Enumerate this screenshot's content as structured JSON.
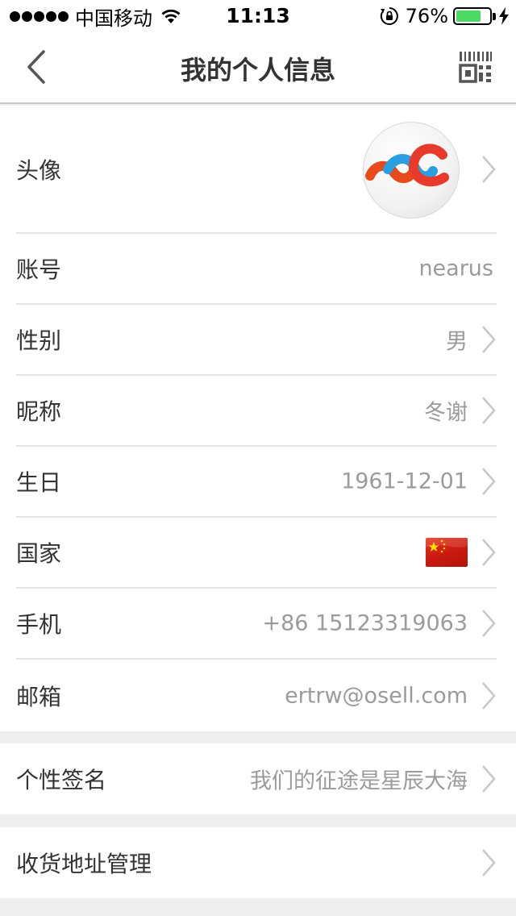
{
  "status_bar": {
    "carrier": "中国移动",
    "time": "11:13",
    "battery_percent": "76%",
    "battery_level": 0.76
  },
  "nav": {
    "title": "我的个人信息",
    "back_icon": "chevron-left-icon",
    "qr_icon": "qr-code-icon"
  },
  "profile": {
    "avatar_label": "头像",
    "account_label": "账号",
    "account_value": "nearus",
    "gender_label": "性别",
    "gender_value": "男",
    "nickname_label": "昵称",
    "nickname_value": "冬谢",
    "birthday_label": "生日",
    "birthday_value": "1961-12-01",
    "country_label": "国家",
    "country_icon": "china-flag-icon",
    "phone_label": "手机",
    "phone_value": "+86 15123319063",
    "email_label": "邮箱",
    "email_value": "ertrw@osell.com"
  },
  "signature": {
    "label": "个性签名",
    "value": "我们的征途是星辰大海"
  },
  "address": {
    "label": "收货地址管理"
  },
  "colors": {
    "accent_green": "#4cd964",
    "label_text": "#333333",
    "value_text": "#9b9b9b",
    "divider": "#e6e6e6",
    "background": "#efefef"
  }
}
